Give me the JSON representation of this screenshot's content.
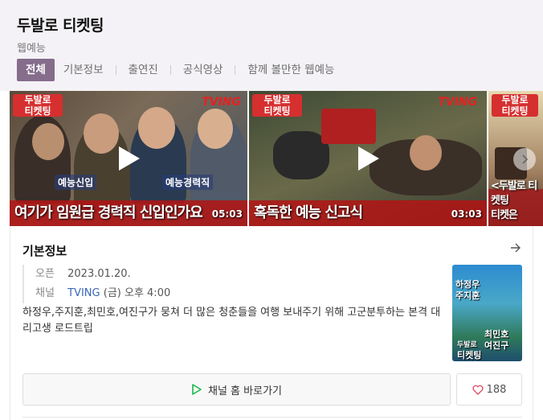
{
  "header": {
    "title": "두발로 티켓팅",
    "subtitle": "웹예능",
    "tabs": [
      {
        "label": "전체",
        "active": true
      },
      {
        "label": "기본정보",
        "active": false
      },
      {
        "label": "출연진",
        "active": false
      },
      {
        "label": "공식영상",
        "active": false
      },
      {
        "label": "함께 볼만한 웹예능",
        "active": false
      }
    ]
  },
  "videos": [
    {
      "badge": "두발로\n티켓팅",
      "logo": "TVING",
      "caption": "여기가 임원급 경력직 신입인가요",
      "duration": "05:03",
      "tags": [
        "예능신입",
        "예능경력직"
      ]
    },
    {
      "badge": "두발로\n티켓팅",
      "logo": "TVING",
      "caption": "혹독한 예능 신고식",
      "duration": "03:03"
    },
    {
      "badge": "두발로\n티켓팅",
      "caption": "<두발로 티켓팅\n티켓은"
    }
  ],
  "info": {
    "title": "기본정보",
    "open_label": "오픈",
    "open_value": "2023.01.20.",
    "channel_label": "채널",
    "channel_name": "TVING",
    "channel_schedule": "(금) 오후 4:00",
    "description": "하정우,주지훈,최민호,여진구가 뭉쳐 더 많은 청춘들을 여행 보내주기 위해 고군분투하는 본격 대리고생 로드트립",
    "poster_text": [
      "하정우",
      "주지훈",
      "최민호",
      "여진구",
      "두발로",
      "티켓팅"
    ]
  },
  "actions": {
    "channel_button": "채널 홈 바로가기",
    "like_count": "188"
  },
  "colors": {
    "accent": "#856d8b",
    "link": "#3a66b8",
    "play_green": "#19b84a",
    "heart": "#e0455a"
  }
}
